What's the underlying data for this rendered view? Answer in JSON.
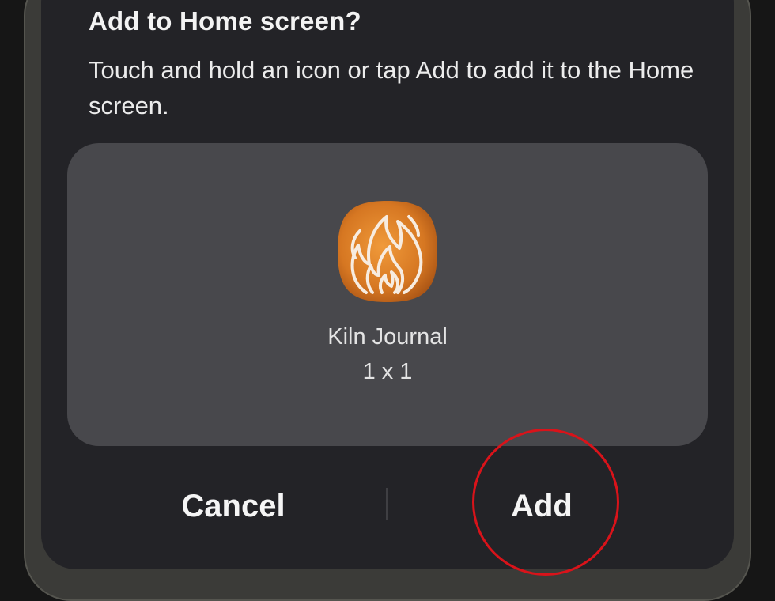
{
  "dialog": {
    "title": "Add to Home screen?",
    "message": "Touch and hold an icon or tap Add to add it to the Home screen."
  },
  "widget": {
    "app_name": "Kiln Journal",
    "size": "1 x 1",
    "icon": "flame-icon",
    "icon_color": "#d87a26"
  },
  "actions": {
    "cancel_label": "Cancel",
    "add_label": "Add"
  },
  "annotation": {
    "color": "#d9131a"
  }
}
